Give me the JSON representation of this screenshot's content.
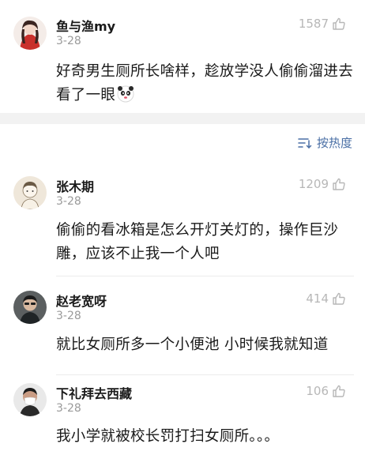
{
  "sort": {
    "label": "按热度"
  },
  "top_comment": {
    "name": "鱼与渔my",
    "date": "3-28",
    "likes": "1587",
    "text": "好奇男生厕所长啥样，趁放学没人偷偷溜进去看了一眼"
  },
  "comments": [
    {
      "name": "张木期",
      "date": "3-28",
      "likes": "1209",
      "text": "偷偷的看冰箱是怎么开灯关灯的，操作巨沙雕，应该不止我一个人吧"
    },
    {
      "name": "赵老宽呀",
      "date": "3-28",
      "likes": "414",
      "text": "就比女厕所多一个小便池 小时候我就知道"
    },
    {
      "name": "下礼拜去西藏",
      "date": "3-28",
      "likes": "106",
      "text": "我小学就被校长罚打扫女厕所。。。"
    }
  ],
  "icons": {
    "like": "thumbs-up-icon",
    "sort": "sort-lines-icon",
    "emoji": "panda-emoji-icon"
  },
  "colors": {
    "sort_link": "#4a6fa5",
    "meta_gray": "#9a9a9a",
    "like_gray": "#b7b7b7",
    "band": "#f2f2f2"
  }
}
